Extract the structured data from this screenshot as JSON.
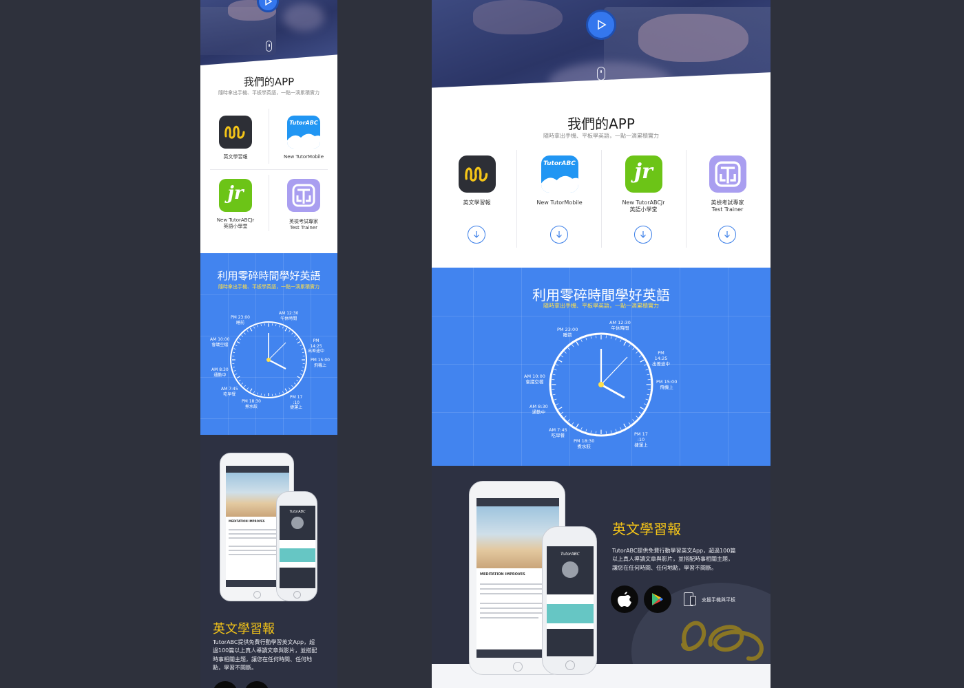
{
  "apps_section": {
    "title": "我們的APP",
    "subtitle": "隨時拿出手機、平板學英語，一點一滴累積實力",
    "apps": [
      {
        "name": "英文學習報",
        "name2": "",
        "icon": "english-news-icon",
        "color": "#2d2f36"
      },
      {
        "name": "New TutorMobile",
        "name2": "",
        "icon": "tutorabc-mobile-icon",
        "brand": "TutorABC",
        "color": "#2196f3"
      },
      {
        "name": "New TutorABCJr",
        "name2": "英語小學堂",
        "icon": "tutorabc-jr-icon",
        "brand": "jr",
        "color": "#6cc417"
      },
      {
        "name": "英檢考試專家",
        "name2": "Test Trainer",
        "icon": "test-trainer-icon",
        "color": "#a99ef0"
      }
    ]
  },
  "time_section": {
    "title": "利用零碎時間學好英語",
    "subtitle": "隨時拿出手機、平板學英語，一點一滴累積實力",
    "labels": [
      {
        "time": "PM 23:00",
        "text": "睡前"
      },
      {
        "time": "AM 12:30",
        "text": "午休時間"
      },
      {
        "time": "PM 14:25",
        "text": "出差途中"
      },
      {
        "time": "PM 15:00",
        "text": "飛機上"
      },
      {
        "time": "PM 17:10",
        "text": "捷運上"
      },
      {
        "time": "PM 18:30",
        "text": "煮水餃"
      },
      {
        "time": "AM 7:45",
        "text": "吃早餐"
      },
      {
        "time": "AM 8:30",
        "text": "通勤中"
      },
      {
        "time": "AM 10:00",
        "text": "會議空檔"
      }
    ],
    "mobile_labels": {
      "pm14_line1": "PM",
      "pm14_line2": "14:25",
      "pm17_line1": "PM 17",
      "pm17_line2": ":10"
    }
  },
  "feature_section": {
    "title": "英文學習報",
    "description": "TutorABC提供免費行動學習英文App，超過100篇以上真人導讀文章與影片，並搭配時事相關主題，讓您在任何時間、任何地點，學習不間斷。",
    "desktop_desc_lines": [
      "TutorABC提供免費行動學習英文App，超過100篇",
      "以上真人導讀文章與影片，並搭配時事相關主題，",
      "讓您在任何時間、任何地點，學習不間斷。"
    ],
    "mobile_desc_lines": [
      "TutorABC提供免費行動學習英文App，超",
      "過100篇以上真人導讀文章與影片，並搭配",
      "時事相關主題，讓您在任何時間、任何地",
      "點，學習不間斷。"
    ],
    "devices_label": "支援手機與平板",
    "ipad_heading": "MEDITATION IMPROVES",
    "phone_brand": "TutorABC",
    "stores": [
      "apple-store-icon",
      "google-play-icon"
    ],
    "accent_color": "#f5c518"
  }
}
